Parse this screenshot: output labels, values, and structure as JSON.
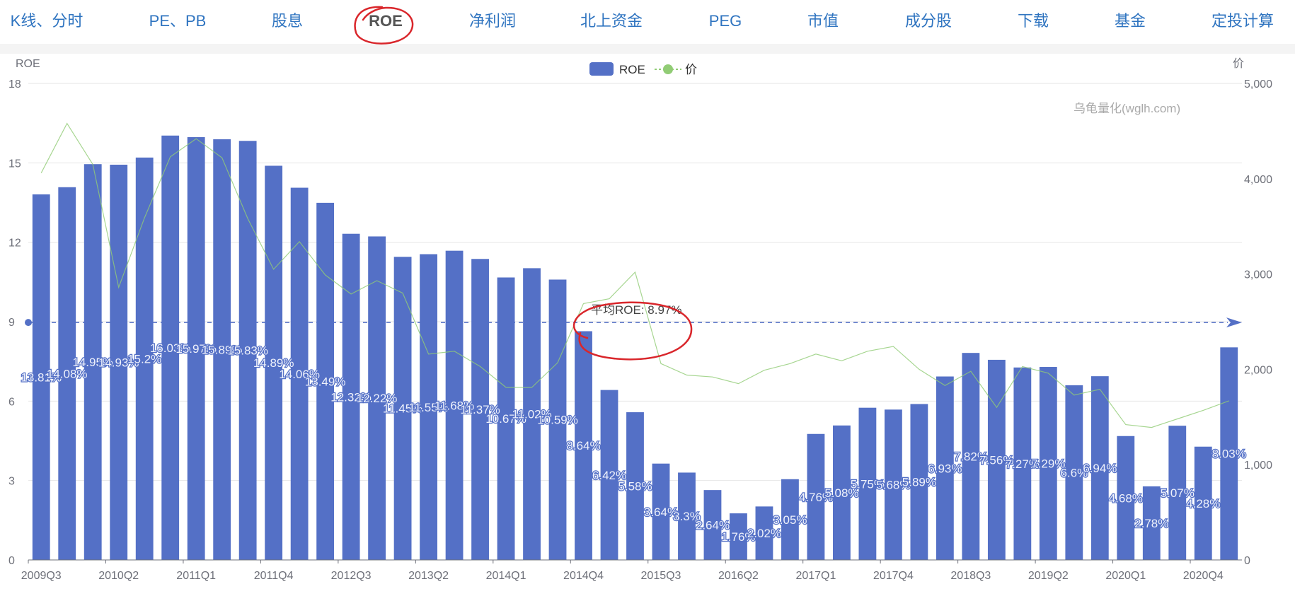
{
  "nav": {
    "items": [
      {
        "label": "K线、分时",
        "active": false
      },
      {
        "label": "PE、PB",
        "active": false
      },
      {
        "label": "股息",
        "active": false
      },
      {
        "label": "ROE",
        "active": true
      },
      {
        "label": "净利润",
        "active": false
      },
      {
        "label": "北上资金",
        "active": false
      },
      {
        "label": "PEG",
        "active": false
      },
      {
        "label": "市值",
        "active": false
      },
      {
        "label": "成分股",
        "active": false
      },
      {
        "label": "下载",
        "active": false
      },
      {
        "label": "基金",
        "active": false
      },
      {
        "label": "定投计算",
        "active": false
      }
    ]
  },
  "chart_data": {
    "type": "bar",
    "ylabel": "ROE",
    "y2label": "价",
    "watermark": "乌龟量化(wglh.com)",
    "ylim": [
      0,
      18
    ],
    "y_ticks": [
      0,
      3,
      6,
      9,
      12,
      15,
      18
    ],
    "y2lim": [
      0,
      5000
    ],
    "y2_ticks": [
      "0",
      "1,000",
      "2,000",
      "3,000",
      "4,000",
      "5,000"
    ],
    "grid": true,
    "legend": "top-center",
    "categories": [
      "2009Q3",
      "2009Q4",
      "2010Q1",
      "2010Q2",
      "2010Q3",
      "2010Q4",
      "2011Q1",
      "2011Q2",
      "2011Q3",
      "2011Q4",
      "2012Q1",
      "2012Q2",
      "2012Q3",
      "2012Q4",
      "2013Q1",
      "2013Q2",
      "2013Q3",
      "2013Q4",
      "2014Q1",
      "2014Q2",
      "2014Q3",
      "2014Q4",
      "2015Q1",
      "2015Q2",
      "2015Q3",
      "2015Q4",
      "2016Q1",
      "2016Q2",
      "2016Q3",
      "2016Q4",
      "2017Q1",
      "2017Q2",
      "2017Q3",
      "2017Q4",
      "2018Q1",
      "2018Q2",
      "2018Q3",
      "2018Q4",
      "2019Q1",
      "2019Q2",
      "2019Q3",
      "2019Q4",
      "2020Q1",
      "2020Q2",
      "2020Q3",
      "2020Q4",
      "2021Q1"
    ],
    "x_tick_labels": [
      "2009Q3",
      "2010Q2",
      "2011Q1",
      "2011Q4",
      "2012Q3",
      "2013Q2",
      "2014Q1",
      "2014Q4",
      "2015Q3",
      "2016Q2",
      "2017Q1",
      "2017Q4",
      "2018Q3",
      "2019Q2",
      "2020Q1",
      "2020Q4"
    ],
    "series": [
      {
        "name": "ROE",
        "type": "bar",
        "color": "#5470c6",
        "values": [
          13.81,
          14.08,
          14.95,
          14.93,
          15.2,
          16.03,
          15.97,
          15.89,
          15.83,
          14.89,
          14.06,
          13.49,
          12.32,
          12.22,
          11.45,
          11.55,
          11.68,
          11.37,
          10.67,
          11.02,
          10.59,
          8.64,
          6.42,
          5.58,
          3.64,
          3.3,
          2.64,
          1.76,
          2.02,
          3.05,
          4.76,
          5.08,
          5.75,
          5.68,
          5.89,
          6.93,
          7.82,
          7.56,
          7.27,
          7.29,
          6.6,
          6.94,
          4.68,
          2.78,
          5.07,
          4.28,
          8.03
        ],
        "labels": [
          "13.81%",
          "14.08%",
          "14.95%",
          "14.93%",
          "15.2%",
          "16.03%",
          "15.97%",
          "15.89%",
          "15.83%",
          "14.89%",
          "14.06%",
          "13.49%",
          "12.32%",
          "12.22%",
          "11.45%",
          "11.55%",
          "11.68%",
          "11.37%",
          "10.67%",
          "11.02%",
          "10.59%",
          "8.64%",
          "6.42%",
          "5.58%",
          "3.64%",
          "3.3%",
          "2.64%",
          "1.76%",
          "2.02%",
          "3.05%",
          "4.76%",
          "5.08%",
          "5.75%",
          "5.68%",
          "5.89%",
          "6.93%",
          "7.82%",
          "7.56%",
          "7.27%",
          "7.29%",
          "6.6%",
          "6.94%",
          "4.68%",
          "2.78%",
          "5.07%",
          "4.28%",
          "8.03%"
        ]
      },
      {
        "name": "价",
        "type": "line",
        "axis": "right",
        "color": "#91cc75",
        "values": [
          4060,
          4580,
          4150,
          2860,
          3590,
          4230,
          4420,
          4220,
          3580,
          3050,
          3340,
          2990,
          2790,
          2930,
          2800,
          2160,
          2190,
          2030,
          1810,
          1810,
          2070,
          2690,
          2740,
          3020,
          2060,
          1940,
          1920,
          1850,
          1990,
          2060,
          2160,
          2090,
          2190,
          2240,
          2000,
          1830,
          1980,
          1600,
          2030,
          1960,
          1730,
          1790,
          1420,
          1390,
          1480,
          1570,
          1670
        ]
      }
    ],
    "average_line": {
      "label": "平均ROE: 8.97%",
      "value": 8.97
    }
  }
}
